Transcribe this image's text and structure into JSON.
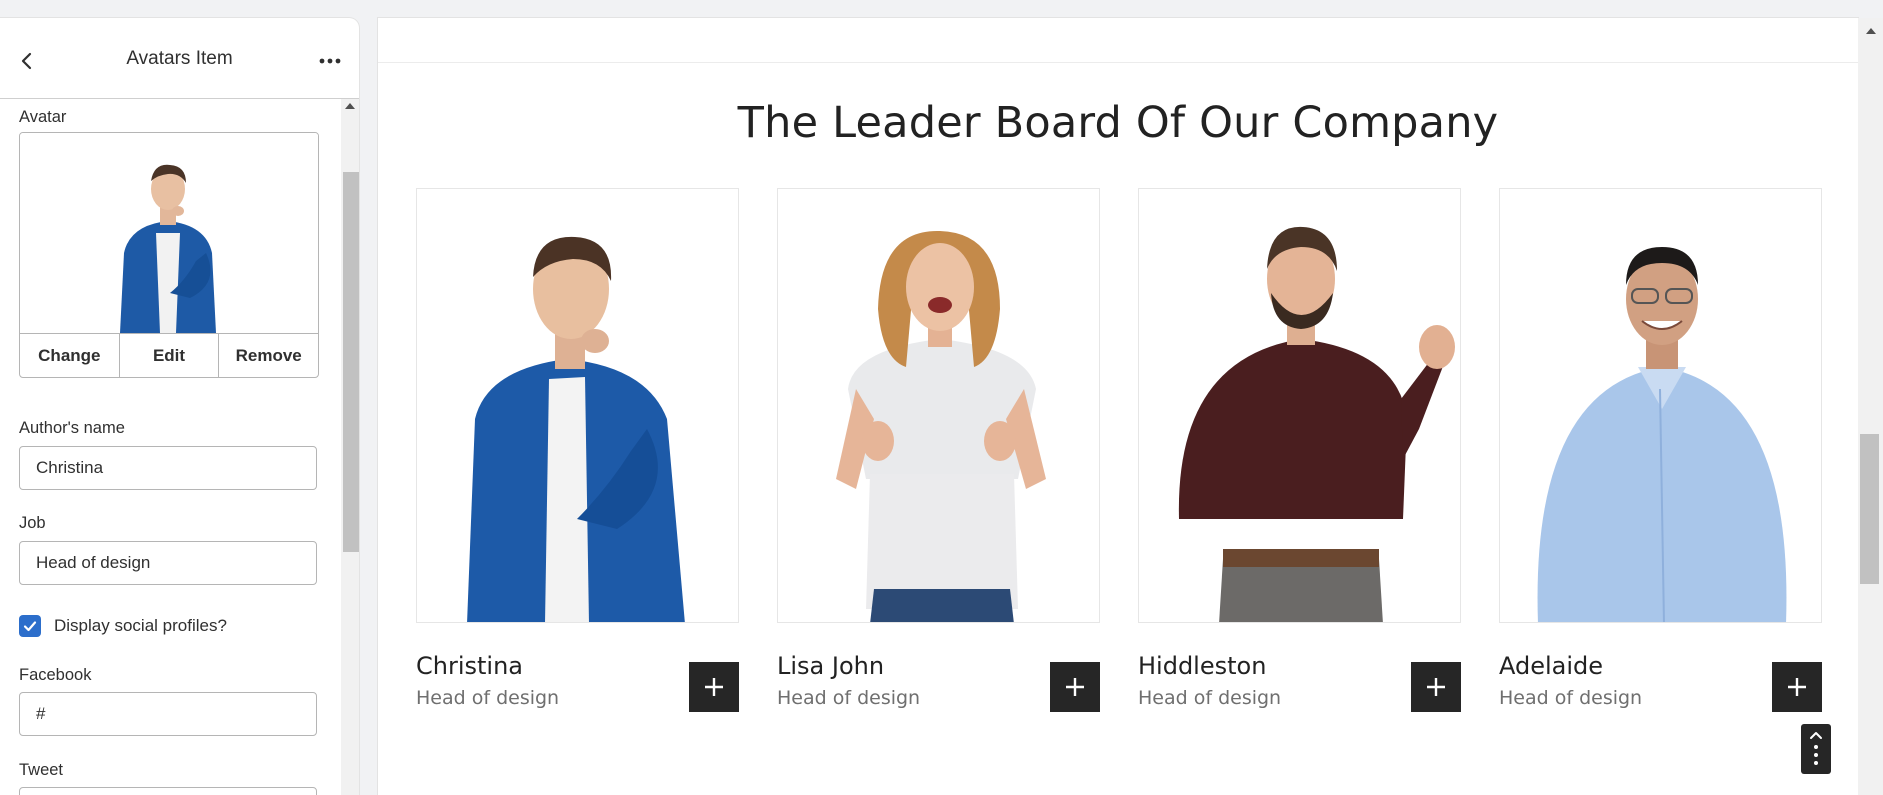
{
  "panel": {
    "title": "Avatars Item",
    "avatar_label": "Avatar",
    "avatar_actions": [
      "Change",
      "Edit",
      "Remove"
    ],
    "author_name_label": "Author's name",
    "author_name_value": "Christina",
    "job_label": "Job",
    "job_value": "Head of design",
    "social_checkbox_label": "Display social profiles?",
    "social_checkbox_checked": true,
    "facebook_label": "Facebook",
    "facebook_value": "#",
    "tweet_label": "Tweet",
    "tweet_value": "#"
  },
  "preview": {
    "section_title": "The Leader Board Of Our Company",
    "members": [
      {
        "name": "Christina",
        "job": "Head of design"
      },
      {
        "name": "Lisa John",
        "job": "Head of design"
      },
      {
        "name": "Hiddleston",
        "job": "Head of design"
      },
      {
        "name": "Adelaide",
        "job": "Head of design"
      }
    ]
  },
  "colors": {
    "accent": "#2c6ecb",
    "dark_button": "#262626"
  }
}
